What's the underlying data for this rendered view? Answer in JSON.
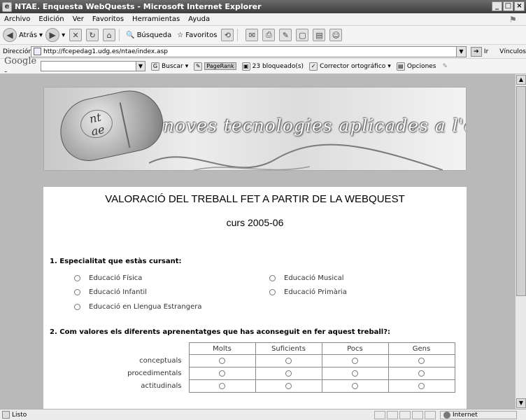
{
  "window": {
    "title": "NTAE. Enquesta WebQuests - Microsoft Internet Explorer",
    "controls": [
      "_",
      "□",
      "×"
    ]
  },
  "menubar": {
    "items": [
      "Archivo",
      "Edición",
      "Ver",
      "Favoritos",
      "Herramientas",
      "Ayuda"
    ]
  },
  "toolbar": {
    "back_label": "Atrás",
    "search_label": "Búsqueda",
    "favorites_label": "Favoritos"
  },
  "addressbar": {
    "label": "Dirección",
    "url": "http://fcepedag1.udg.es/ntae/index.asp",
    "go_label": "Ir",
    "links_label": "Vínculos"
  },
  "googlebar": {
    "logo": "Google -",
    "search_label": "Buscar",
    "pagerank_label": "PageRank",
    "blocked_label": "23 bloqueado(s)",
    "spell_label": "Corrector ortográfico",
    "options_label": "Opciones"
  },
  "banner": {
    "title": "noves tecnologies aplicades a l'educació",
    "logo_text": "nt\nae"
  },
  "form": {
    "heading": "VALORACIÓ DEL TREBALL FET A PARTIR DE LA WEBQUEST",
    "subheading": "curs 2005-06",
    "q1": {
      "label": "1. Especialitat que estàs cursant:",
      "options": [
        "Educació Física",
        "Educació Musical",
        "Educació Infantil",
        "Educació Primària",
        "Educació en Llengua Estrangera"
      ]
    },
    "q2": {
      "label": "2. Com valores els diferents aprenentatges que has aconseguit en fer aquest treball?:",
      "columns": [
        "Molts",
        "Suficients",
        "Pocs",
        "Gens"
      ],
      "rows": [
        "conceptuals",
        "procedimentals",
        "actitudinals"
      ]
    }
  },
  "statusbar": {
    "status": "Listo",
    "zone": "Internet"
  }
}
